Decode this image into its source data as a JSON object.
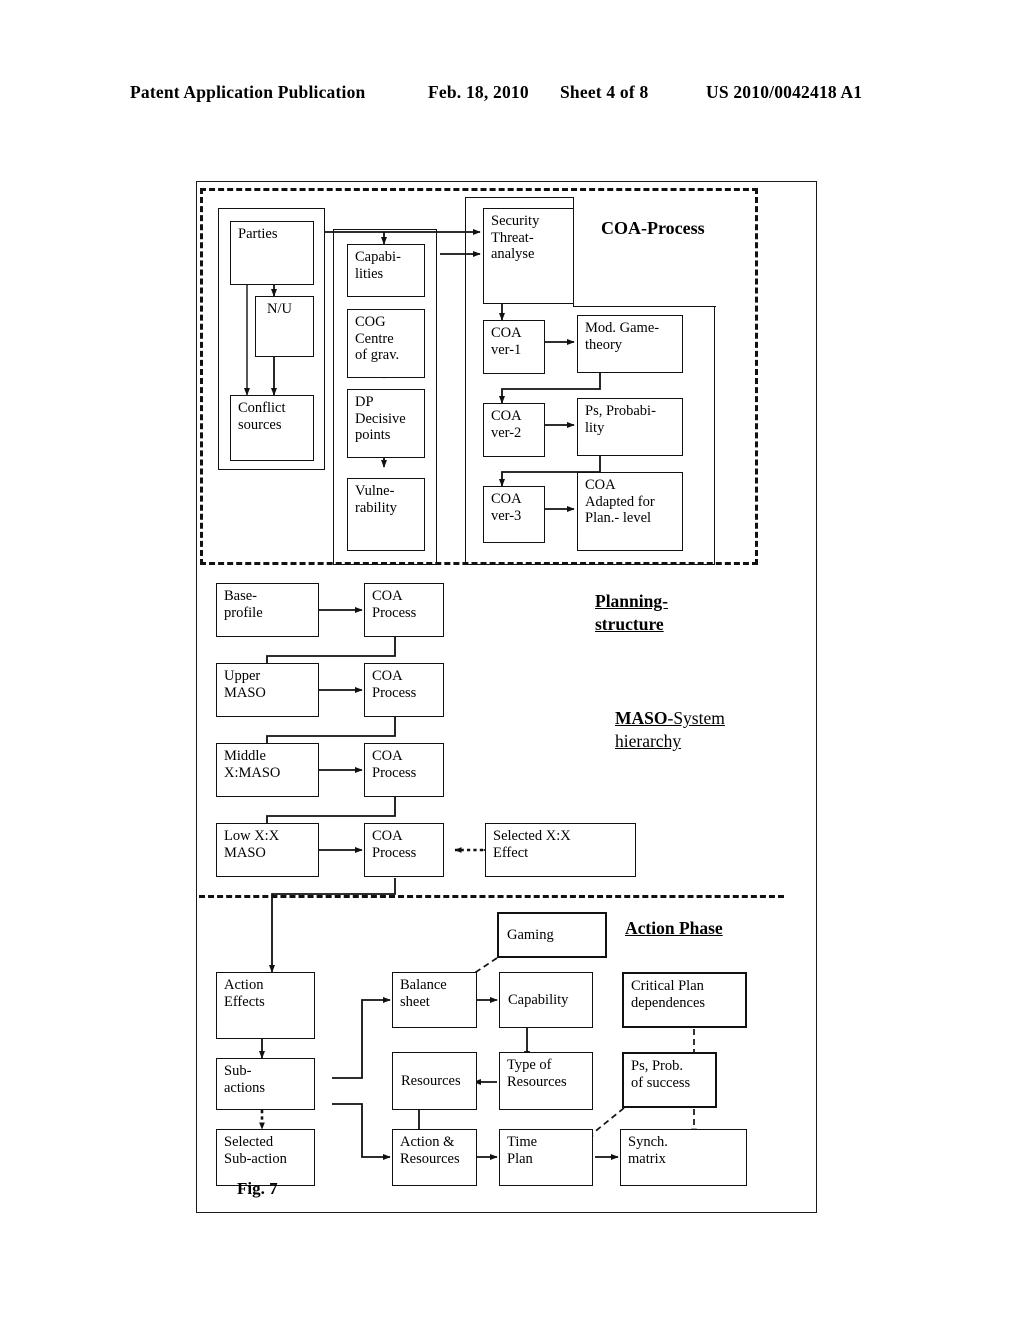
{
  "header": {
    "publication": "Patent Application Publication",
    "date": "Feb. 18, 2010",
    "sheet": "Sheet 4 of 8",
    "patent_number": "US 2010/0042418 A1"
  },
  "figure": {
    "label": "Fig. 7",
    "captions": {
      "coa_process": "COA-Process",
      "planning_structure_line1": "Planning-",
      "planning_structure_line2": "structure",
      "maso_bold": "MASO",
      "maso_rest": "-System",
      "maso_line2": "hierarchy",
      "action_phase": "Action Phase"
    },
    "sections": {
      "coa_process": {
        "situation_boxes": [
          {
            "id": "parties",
            "text": "Parties"
          },
          {
            "id": "nu",
            "text": "N/U"
          },
          {
            "id": "conflict",
            "line1": "Conflict",
            "line2": "sources"
          }
        ],
        "capability_boxes": [
          {
            "id": "capabilities",
            "line1": "Capabi-",
            "line2": "lities"
          },
          {
            "id": "cog",
            "line1": "COG",
            "line2": "Centre",
            "line3": "of grav."
          },
          {
            "id": "dp",
            "line1": "DP",
            "line2": "Decisive",
            "line3": "points"
          },
          {
            "id": "vulnerability",
            "line1": "Vulne-",
            "line2": "rability"
          }
        ],
        "coa_boxes": [
          {
            "id": "security",
            "line1": "Security",
            "line2": "Threat-",
            "line3": "analyse"
          },
          {
            "id": "coa-ver-1",
            "line1": "COA",
            "line2": "ver-1"
          },
          {
            "id": "gametheory",
            "line1": "Mod. Game-",
            "line2": "theory"
          },
          {
            "id": "coa-ver-2",
            "line1": "COA",
            "line2": "ver-2"
          },
          {
            "id": "probability",
            "line1": "Ps, Probabi-",
            "line2": "lity"
          },
          {
            "id": "coa-ver-3",
            "line1": "COA",
            "line2": "ver-3"
          },
          {
            "id": "coa-adapted",
            "line1": "COA",
            "line2": "Adapted for",
            "line3": "Plan.- level"
          }
        ]
      },
      "planning_structure": {
        "levels": [
          {
            "id": "base-profile",
            "line1": "Base-",
            "line2": "profile",
            "process1": "COA",
            "process2": "Process"
          },
          {
            "id": "upper-maso",
            "line1": "Upper",
            "line2": "MASO",
            "process1": "COA",
            "process2": "Process"
          },
          {
            "id": "middle-maso",
            "line1": "Middle",
            "line2": "X:MASO",
            "process1": "COA",
            "process2": "Process"
          },
          {
            "id": "low-maso",
            "line1": "Low  X:X",
            "line2": "MASO",
            "process1": "COA",
            "process2": "Process"
          }
        ],
        "selected_effect": {
          "line1": "Selected  X:X",
          "line2": "Effect"
        }
      },
      "action_phase": {
        "boxes": [
          {
            "id": "gaming",
            "line1": "Gaming"
          },
          {
            "id": "action-effects",
            "line1": "Action",
            "line2": "Effects"
          },
          {
            "id": "balance-sheet",
            "line1": "Balance",
            "line2": "sheet"
          },
          {
            "id": "capability",
            "line1": "Capability"
          },
          {
            "id": "critical-plan",
            "line1": "Critical Plan",
            "line2": "dependences"
          },
          {
            "id": "sub-actions",
            "line1": "Sub-",
            "line2": "actions"
          },
          {
            "id": "resources",
            "line1": "Resources"
          },
          {
            "id": "type-of-resources",
            "line1": "Type of",
            "line2": "Resources"
          },
          {
            "id": "ps-prob",
            "line1": "Ps, Prob.",
            "line2": "of success"
          },
          {
            "id": "selected-sub",
            "line1": "Selected",
            "line2": "Sub-action"
          },
          {
            "id": "action-resources",
            "line1": "Action &",
            "line2": "Resources"
          },
          {
            "id": "time-plan",
            "line1": "Time",
            "line2": "Plan"
          },
          {
            "id": "synch-matrix",
            "line1": "Synch.",
            "line2": "matrix"
          }
        ]
      }
    }
  }
}
